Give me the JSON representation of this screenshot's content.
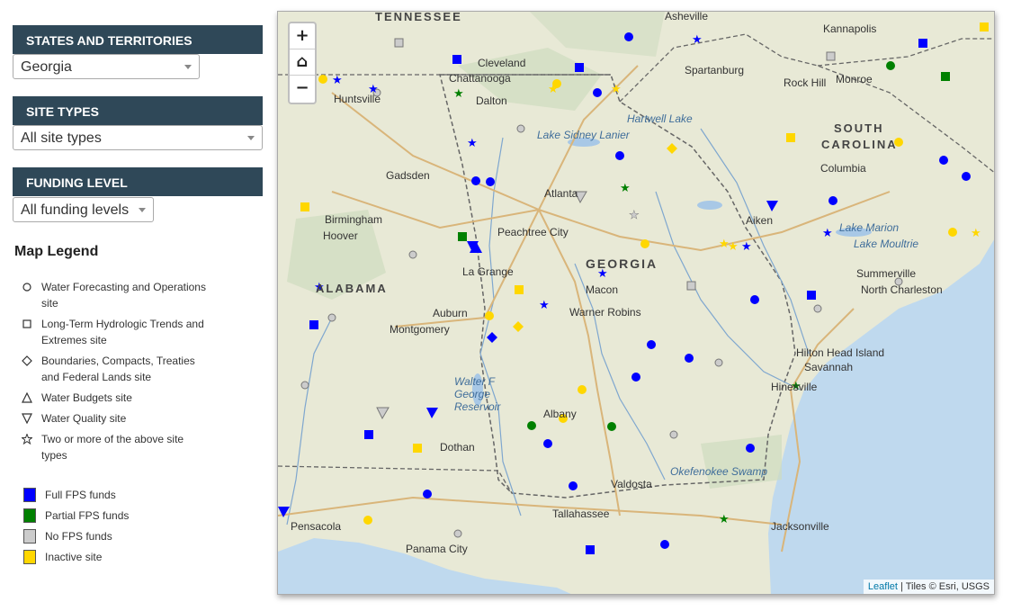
{
  "filters": {
    "states": {
      "header": "STATES AND TERRITORIES",
      "selected": "Georgia"
    },
    "site_types": {
      "header": "SITE TYPES",
      "selected": "All site types"
    },
    "funding": {
      "header": "FUNDING LEVEL",
      "selected": "All funding levels"
    }
  },
  "legend": {
    "title": "Map Legend",
    "site_types": [
      {
        "icon": "circle-icon",
        "label": "Water Forecasting and Operations site"
      },
      {
        "icon": "square-icon",
        "label": "Long-Term Hydrologic Trends and Extremes site"
      },
      {
        "icon": "diamond-icon",
        "label": "Boundaries, Compacts, Treaties and Federal Lands site"
      },
      {
        "icon": "triangle-up-icon",
        "label": "Water Budgets site"
      },
      {
        "icon": "triangle-down-icon",
        "label": "Water Quality site"
      },
      {
        "icon": "star-icon",
        "label": "Two or more of the above site types"
      }
    ],
    "funding": [
      {
        "label": "Full FPS funds",
        "color": "#0000ff"
      },
      {
        "label": "Partial FPS funds",
        "color": "#008000"
      },
      {
        "label": "No FPS funds",
        "color": "#cccccc"
      },
      {
        "label": "Inactive site",
        "color": "#ffd700"
      }
    ]
  },
  "map": {
    "zoom_in": "+",
    "home": "⌂",
    "zoom_out": "−",
    "attribution_link": "Leaflet",
    "attribution_text": " | Tiles © Esri, USGS",
    "labels": {
      "tennessee": "TENNESSEE",
      "georgia": "GEORGIA",
      "alabama": "ALABAMA",
      "south_carolina_1": "SOUTH",
      "south_carolina_2": "CAROLINA",
      "atlanta": "Atlanta",
      "macon": "Macon",
      "albany": "Albany",
      "valdosta": "Valdosta",
      "tallahassee": "Tallahassee",
      "jacksonville": "Jacksonville",
      "savannah": "Savannah",
      "columbia": "Columbia",
      "augusta": "Aiken",
      "montgomery": "Montgomery",
      "birmingham": "Birmingham",
      "huntsville": "Huntsville",
      "chattanooga": "Chattanooga",
      "panama_city": "Panama City",
      "pensacola": "Pensacola",
      "dothan": "Dothan",
      "auburn": "Auburn",
      "la_grange": "La Grange",
      "hinesville": "Hinesville",
      "lake_sidney_lanier": "Lake Sidney Lanier",
      "hartwell_lake": "Hartwell Lake",
      "walter_f_george": "Walter F George Reservoir",
      "okefenokee": "Okefenokee Swamp",
      "lake_marion": "Lake Marion",
      "lake_moultrie": "Lake Moultrie",
      "hilton_head": "Hilton Head Island",
      "spartanburg": "Spartanburg",
      "asheville": "Asheville",
      "kannapolis": "Kannapolis",
      "cleveland": "Cleveland",
      "dalton": "Dalton",
      "summerville": "Summerville",
      "north_charleston": "North Charleston",
      "warner_robins": "Warner Robins",
      "peachtree_city": "Peachtree City",
      "gadsden": "Gadsden",
      "hoover": "Hoover",
      "monroe": "Monroe",
      "rock_hill": "Rock Hill"
    }
  }
}
